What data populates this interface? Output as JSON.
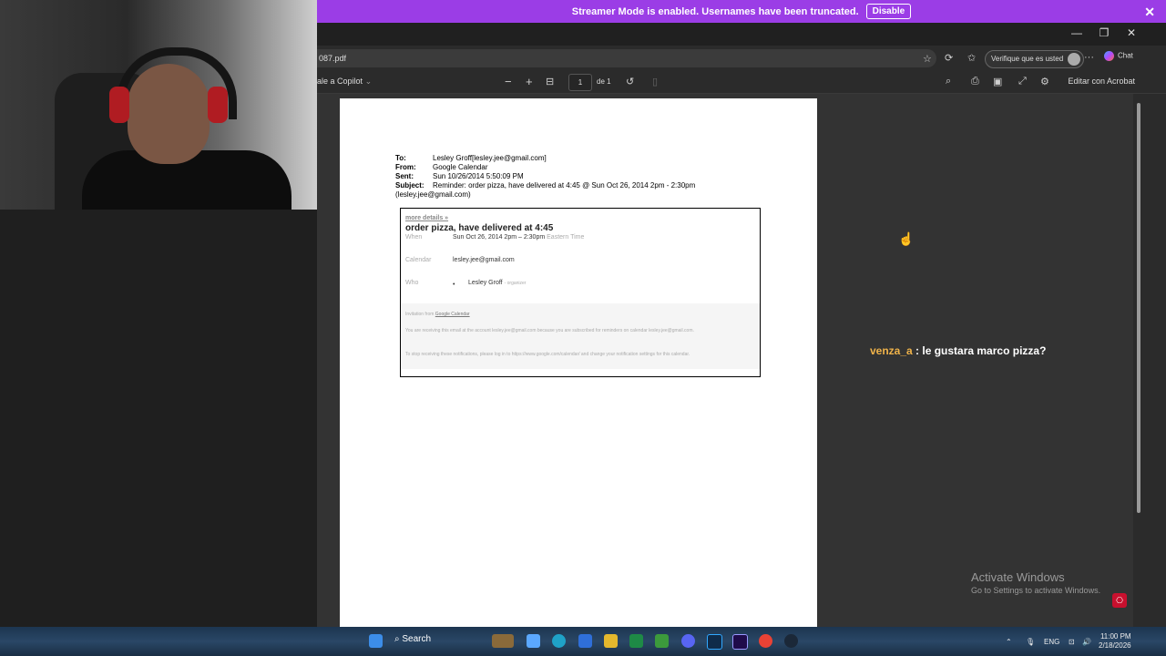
{
  "banner": {
    "text": "Streamer Mode is enabled. Usernames have been truncated.",
    "button": "Disable",
    "close": "✕"
  },
  "window": {
    "minimize": "—",
    "restore": "❐",
    "close": "✕"
  },
  "browser": {
    "url": "087.pdf",
    "verify": "Verifique que es usted",
    "more": "···",
    "chat": "Chat"
  },
  "pdf_toolbar": {
    "copilot": "ale a Copilot",
    "zoom_out": "−",
    "zoom_in": "+",
    "page": "1",
    "of": "de 1",
    "edit": "Editar con Acrobat"
  },
  "email": {
    "to_label": "To:",
    "to": "Lesley Groff[lesley.jee@gmail.com]",
    "from_label": "From:",
    "from": "Google Calendar",
    "sent_label": "Sent:",
    "sent": "Sun 10/26/2014 5:50:09 PM",
    "subject_label": "Subject:",
    "subject": "Reminder: order pizza, have delivered at 4:45 @ Sun Oct 26, 2014 2pm - 2:30pm",
    "subject_cont": "(lesley.jee@gmail.com)"
  },
  "card": {
    "more_details": "more details »",
    "event_title": "order pizza, have delivered at 4:45",
    "when_label": "When",
    "when": "Sun Oct 26, 2014 2pm – 2:30pm",
    "timezone": "Eastern Time",
    "calendar_label": "Calendar",
    "calendar": "lesley.jee@gmail.com",
    "who_label": "Who",
    "who_bullet": "•",
    "who": "Lesley Groff",
    "who_role": "- organizer",
    "invitation_prefix": "Invitation from",
    "invitation_link": "Google Calendar",
    "footer1": "You are receiving this email at the account lesley.jee@gmail.com because you are subscribed for reminders on calendar lesley.jee@gmail.com.",
    "footer2": "To stop receiving these notifications, please log in to https://www.google.com/calendar/ and change your notification settings for this calendar."
  },
  "chat_overlay": {
    "user": "venza_a",
    "message": " : le gustara marco pizza?"
  },
  "watermark": {
    "line1": "Activate Windows",
    "line2": "Go to Settings to activate Windows."
  },
  "taskbar": {
    "search": "Search",
    "lang": "ENG",
    "time": "11:00 PM",
    "date": "2/18/2026"
  }
}
